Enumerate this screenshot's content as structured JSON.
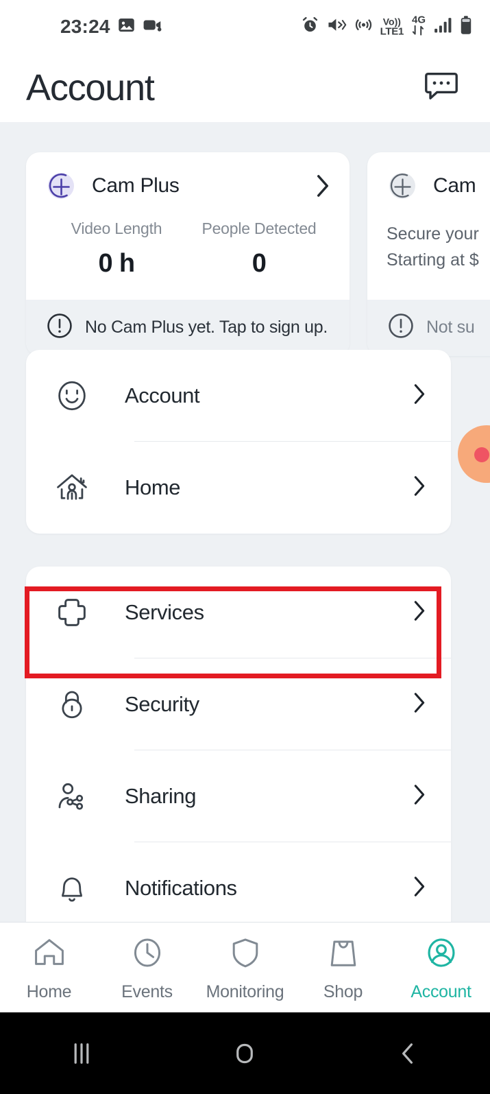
{
  "statusbar": {
    "time": "23:24",
    "left_icons": [
      "image-icon",
      "video-camera-icon"
    ],
    "right_icons": [
      "alarm-icon",
      "mute-vibrate-icon",
      "hotspot-icon"
    ],
    "volte": {
      "line1": "Vo))",
      "line2": "LTE1"
    },
    "network": {
      "label": "4G",
      "arrows": "data-transfer-icon"
    },
    "signal": "signal-bars-icon",
    "battery": "battery-icon"
  },
  "header": {
    "title": "Account",
    "action_icon": "chat-bubble-icon"
  },
  "promo_cards": [
    {
      "icon": "cam-plus-add-icon",
      "icon_color": "#4b3fa8",
      "icon_bg": "#e4e2f6",
      "title": "Cam Plus",
      "chevron": "chevron-right-icon",
      "stats": [
        {
          "label": "Video Length",
          "value": "0 h"
        },
        {
          "label": "People Detected",
          "value": "0"
        }
      ],
      "footer_icon": "alert-circle-icon",
      "footer_text": "No Cam Plus yet. Tap to sign up.",
      "footer_muted": false
    },
    {
      "icon": "cam-plus-add-icon",
      "icon_color": "#5a626c",
      "icon_bg": "#e7eaee",
      "title": "Cam",
      "chevron": "chevron-right-icon",
      "promo_line1": "Secure your",
      "promo_line2": "Starting at $",
      "footer_icon": "alert-circle-icon",
      "footer_text": "Not su",
      "footer_muted": true
    }
  ],
  "menu_groups": [
    {
      "items": [
        {
          "icon": "smiley-face-icon",
          "label": "Account",
          "chevron": "chevron-right-icon"
        },
        {
          "icon": "home-person-icon",
          "label": "Home",
          "chevron": "chevron-right-icon"
        }
      ]
    },
    {
      "items": [
        {
          "icon": "plus-cross-icon",
          "label": "Services",
          "chevron": "chevron-right-icon",
          "highlighted": true
        },
        {
          "icon": "lock-icon",
          "label": "Security",
          "chevron": "chevron-right-icon"
        },
        {
          "icon": "share-person-icon",
          "label": "Sharing",
          "chevron": "chevron-right-icon"
        },
        {
          "icon": "bell-icon",
          "label": "Notifications",
          "chevron": "chevron-right-icon"
        }
      ]
    }
  ],
  "highlight": {
    "color": "#e31b23",
    "target": "Services"
  },
  "floating_bubble": {
    "color": "#f7a97a",
    "dot_color": "#ef5463"
  },
  "bottom_nav": {
    "active_color": "#1fb5a3",
    "inactive_color": "#6b737c",
    "items": [
      {
        "icon": "home-icon",
        "label": "Home",
        "active": false
      },
      {
        "icon": "clock-icon",
        "label": "Events",
        "active": false
      },
      {
        "icon": "shield-icon",
        "label": "Monitoring",
        "active": false
      },
      {
        "icon": "shopping-bag-icon",
        "label": "Shop",
        "active": false
      },
      {
        "icon": "user-circle-icon",
        "label": "Account",
        "active": true
      }
    ]
  },
  "android_nav": {
    "buttons": [
      "recents-icon",
      "home-circle-icon",
      "back-icon"
    ]
  }
}
